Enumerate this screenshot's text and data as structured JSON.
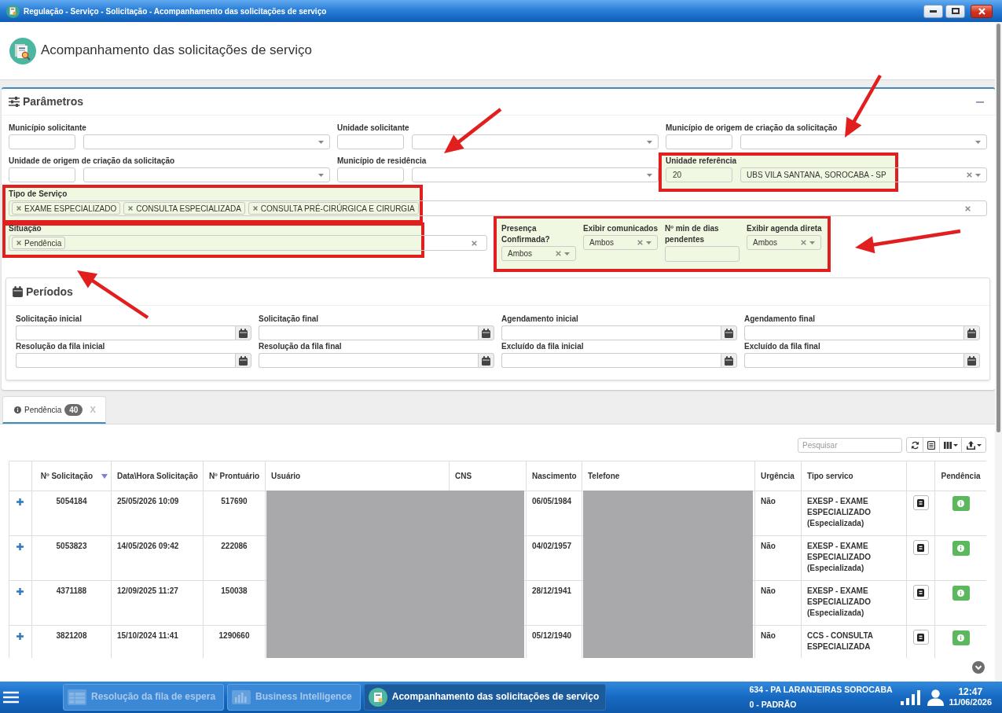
{
  "window": {
    "title": "Regulação - Serviço - Solicitação - Acompanhamento das solicitações de serviço"
  },
  "page_header": {
    "title": "Acompanhamento das solicitações de serviço"
  },
  "parameters": {
    "title": "Parâmetros",
    "expanded": true,
    "selects": [
      {
        "label": "Município solicitante",
        "highlighted": false
      },
      {
        "label": "Unidade solicitante",
        "highlighted": false
      },
      {
        "label": "Município de origem de criação da solicitação",
        "highlighted": false
      },
      {
        "label": "Unidade de origem de criação da solicitação",
        "highlighted": false
      },
      {
        "label": "Município de residência",
        "highlighted": false
      },
      {
        "label": "Unidade referência",
        "code": "20",
        "value": "UBS VILA SANTANA, SOROCABA - SP",
        "highlighted": true
      }
    ],
    "service_type": {
      "label": "Tipo de Serviço",
      "tags": [
        "EXAME ESPECIALIZADO",
        "CONSULTA ESPECIALIZADA",
        "CONSULTA PRÉ-CIRÚRGICA E CIRURGIA"
      ],
      "highlighted": true
    },
    "situation": {
      "label": "Situação",
      "tags": [
        "Pendência"
      ],
      "highlighted": true
    },
    "filters": {
      "highlighted": true,
      "fields": [
        {
          "kind": "select",
          "label": "Presença Confirmada?",
          "value": "Ambos"
        },
        {
          "kind": "select",
          "label": "Exibir comunicados",
          "value": "Ambos"
        },
        {
          "kind": "number",
          "label": "Nº min de dias pendentes"
        },
        {
          "kind": "select",
          "label": "Exibir agenda direta",
          "value": "Ambos"
        }
      ]
    }
  },
  "periods": {
    "title": "Períodos",
    "fields": [
      {
        "label": "Solicitação inicial"
      },
      {
        "label": "Solicitação final"
      },
      {
        "label": "Agendamento inicial"
      },
      {
        "label": "Agendamento final"
      },
      {
        "label": "Resolução da fila inicial"
      },
      {
        "label": "Resolução da fila final"
      },
      {
        "label": "Excluído da fila inicial"
      },
      {
        "label": "Excluído da fila final"
      }
    ]
  },
  "results": {
    "tabs": [
      {
        "label": "Pendência",
        "count": "40",
        "close": "X",
        "selected": true
      }
    ],
    "search": {
      "placeholder": "Pesquisar"
    },
    "columns": [
      {
        "sorted": false,
        "redacted": false
      },
      {
        "label": "Nº Solicitação",
        "sorted": true,
        "redacted": false
      },
      {
        "label": "Data\\Hora Solicitação",
        "sorted": false,
        "redacted": false
      },
      {
        "label": "Nº Prontuário",
        "sorted": false,
        "redacted": false
      },
      {
        "label": "Usuário",
        "sorted": false,
        "redacted": true
      },
      {
        "label": "CNS",
        "sorted": false,
        "redacted": true
      },
      {
        "label": "Nascimento",
        "sorted": false,
        "redacted": false
      },
      {
        "label": "Telefone",
        "sorted": false,
        "redacted": true
      },
      {
        "label": "Urgência",
        "sorted": false,
        "redacted": false
      },
      {
        "label": "Tipo servico",
        "sorted": false,
        "redacted": false
      },
      {
        "sorted": false,
        "redacted": false
      },
      {
        "label": "Pendência",
        "sorted": false,
        "redacted": false
      }
    ],
    "rows": [
      {
        "expanded": false,
        "request_no": "5054184",
        "requested_at": "25/05/2026 10:09",
        "record_no": "517690",
        "birth_date": "06/05/1984",
        "urgency": "Não",
        "service_type": "EXESP - EXAME ESPECIALIZADO (Especializada)"
      },
      {
        "expanded": false,
        "request_no": "5053823",
        "requested_at": "14/05/2026 09:42",
        "record_no": "222086",
        "birth_date": "04/02/1957",
        "urgency": "Não",
        "service_type": "EXESP - EXAME ESPECIALIZADO (Especializada)"
      },
      {
        "expanded": false,
        "request_no": "4371188",
        "requested_at": "12/09/2025 11:27",
        "record_no": "150038",
        "birth_date": "28/12/1941",
        "urgency": "Não",
        "service_type": "EXESP - EXAME ESPECIALIZADO (Especializada)"
      },
      {
        "expanded": false,
        "request_no": "3821208",
        "requested_at": "15/10/2024 11:41",
        "record_no": "1290660",
        "birth_date": "05/12/1940",
        "urgency": "Não",
        "service_type": "CCS - CONSULTA ESPECIALIZADA"
      }
    ]
  },
  "taskbar": {
    "tasks": [
      {
        "label": "Resolução da fila de espera",
        "selected": false
      },
      {
        "label": "Business Intelligence",
        "selected": false
      },
      {
        "label": "Acompanhamento das solicitações de serviço",
        "selected": true
      }
    ],
    "unit": "634 - PA LARANJEIRAS SOROCABA",
    "profile": "0 - PADRÃO",
    "time": "12:47",
    "date": "11/06/2026"
  }
}
